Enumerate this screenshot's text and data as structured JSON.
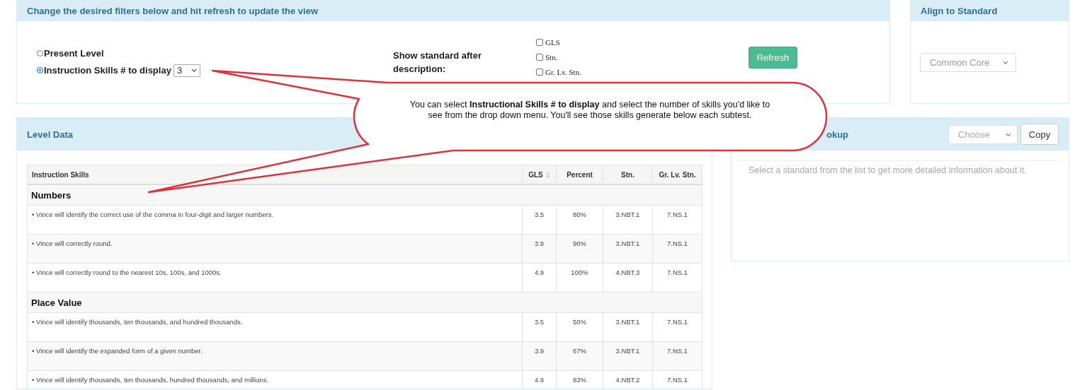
{
  "filters_panel": {
    "title": "Change the desired filters below and hit refresh to update the view",
    "radios": [
      {
        "label": "Present Level",
        "selected": false
      },
      {
        "label": "Instruction Skills # to display",
        "selected": true
      }
    ],
    "skills_count": "3",
    "standard_label": "Show standard after description:",
    "checkboxes": [
      {
        "label": "GLS",
        "checked": false
      },
      {
        "label": "Stn.",
        "checked": false
      },
      {
        "label": "Gr. Lv. Stn.",
        "checked": false
      }
    ],
    "refresh_button": "Refresh"
  },
  "align_panel": {
    "title": "Align to Standard",
    "standard": "Common Core"
  },
  "level_data": {
    "title": "Level Data",
    "columns": [
      {
        "label": "Instruction Skills",
        "sortable": false
      },
      {
        "label": "GLS",
        "sortable": true
      },
      {
        "label": "Percent",
        "sortable": false
      },
      {
        "label": "Stn.",
        "sortable": false
      },
      {
        "label": "Gr. Lv. Stn.",
        "sortable": false
      }
    ],
    "groups": [
      {
        "name": "Numbers",
        "rows": [
          {
            "skill": "• Vince will identify the correct use of the comma in four-digit and larger numbers.",
            "gls": "3.5",
            "percent": "80%",
            "stn": "3.NBT.1",
            "gr_lv_stn": "7.NS.1"
          },
          {
            "skill": "• Vince will correctly round.",
            "gls": "3.9",
            "percent": "90%",
            "stn": "3.NBT.1",
            "gr_lv_stn": "7.NS.1"
          },
          {
            "skill": "• Vince will correctly round to the nearest 10s, 100s, and 1000s.",
            "gls": "4.9",
            "percent": "100%",
            "stn": "4.NBT.3",
            "gr_lv_stn": "7.NS.1"
          }
        ]
      },
      {
        "name": "Place Value",
        "rows": [
          {
            "skill": "• Vince will identify thousands, ten thousands, and hundred thousands.",
            "gls": "3.5",
            "percent": "50%",
            "stn": "3.NBT.1",
            "gr_lv_stn": "7.NS.1"
          },
          {
            "skill": "• Vince will identify the expanded form of a given number.",
            "gls": "3.9",
            "percent": "67%",
            "stn": "3.NBT.1",
            "gr_lv_stn": "7.NS.1"
          },
          {
            "skill": "• Vince will identify thousands, ten thousands, hundred thousands, and millions.",
            "gls": "4.9",
            "percent": "83%",
            "stn": "4.NBT.2",
            "gr_lv_stn": "7.NS.1"
          }
        ]
      }
    ]
  },
  "lookup_panel": {
    "title": "okup",
    "select": "Choose",
    "copy_button": "Copy",
    "hint": "Select a standard from the list to get more detailed information about it."
  },
  "callout": {
    "text": "You can select **Instructional Skills # to display** and select the number of skills you'd like to see from the drop down menu. You'll see those skills generate below each subtest."
  }
}
